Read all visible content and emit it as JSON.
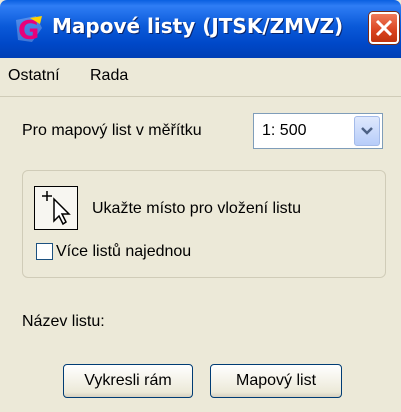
{
  "window": {
    "title": "Mapové listy (JTSK/ZMVZ)",
    "app_icon": "app-g-logo-icon",
    "close_icon": "close-icon",
    "accent": "#0054e3",
    "close_color": "#d9431f"
  },
  "menu": {
    "items": [
      "Ostatní",
      "Rada"
    ]
  },
  "scale": {
    "label": "Pro mapový list v měřítku",
    "selected": "1: 500"
  },
  "placement": {
    "pick_icon": "pick-point-cursor-icon",
    "label": "Ukažte místo pro vložení listu",
    "multi_label": "Více listů najednou",
    "multi_checked": false
  },
  "sheet_name": {
    "label": "Název listu:"
  },
  "buttons": {
    "draw_frame": "Vykresli rám",
    "map_sheet": "Mapový list"
  }
}
